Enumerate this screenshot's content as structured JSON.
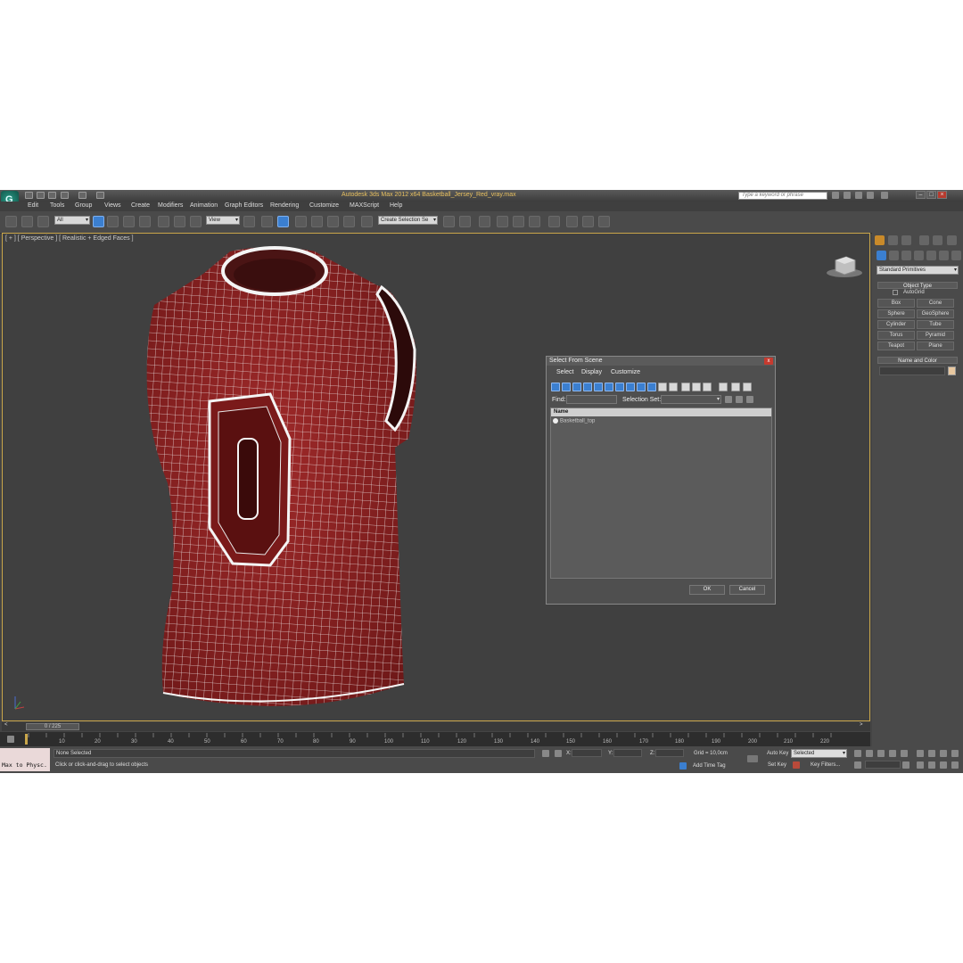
{
  "app": {
    "title": "Autodesk 3ds Max 2012 x64    Basketball_Jersey_Red_vray.max",
    "logo_text": "G",
    "search_placeholder": "Type a keyword or phrase",
    "window_buttons": [
      "–",
      "□",
      "×"
    ]
  },
  "menu": [
    "Edit",
    "Tools",
    "Group",
    "Views",
    "Create",
    "Modifiers",
    "Animation",
    "Graph Editors",
    "Rendering",
    "Customize",
    "MAXScript",
    "Help"
  ],
  "toolbar": {
    "selection_filter": "All",
    "reference_coord": "View",
    "named_selection": "Create Selection Se"
  },
  "viewport": {
    "label": "[ + ] [ Perspective ] [ Realistic + Edged Faces ]",
    "colors": {
      "mesh": "#8e2424",
      "wire": "#ffffff",
      "border": "#c9a64a"
    }
  },
  "dialog": {
    "title": "Select From Scene",
    "close": "x",
    "menu": [
      "Select",
      "Display",
      "Customize"
    ],
    "find_label": "Find:",
    "selection_set_label": "Selection Set:",
    "column_header": "Name",
    "rows": [
      "Basketball_top"
    ],
    "ok": "OK",
    "cancel": "Cancel"
  },
  "command_panel": {
    "category": "Standard Primitives",
    "object_type_title": "Object Type",
    "autogrid": "AutoGrid",
    "buttons": [
      "Box",
      "Cone",
      "Sphere",
      "GeoSphere",
      "Cylinder",
      "Tube",
      "Torus",
      "Pyramid",
      "Teapot",
      "Plane"
    ],
    "name_color_title": "Name and Color",
    "swatch_color": "#e8c8a0"
  },
  "timeline": {
    "slider": "0 / 225",
    "ticks": [
      "10",
      "20",
      "30",
      "40",
      "50",
      "60",
      "70",
      "80",
      "90",
      "100",
      "110",
      "120",
      "130",
      "140",
      "150",
      "160",
      "170",
      "180",
      "190",
      "200",
      "210",
      "220"
    ]
  },
  "status": {
    "maxscript": "Max to Physc.",
    "selection": "None Selected",
    "prompt": "Click or click-and-drag to select objects",
    "x_label": "X:",
    "y_label": "Y:",
    "z_label": "Z:",
    "grid": "Grid = 10,0cm",
    "add_time_tag": "Add Time Tag",
    "auto_key": "Auto Key",
    "set_key": "Set Key",
    "key_mode": "Selected",
    "key_filters": "Key Filters..."
  }
}
